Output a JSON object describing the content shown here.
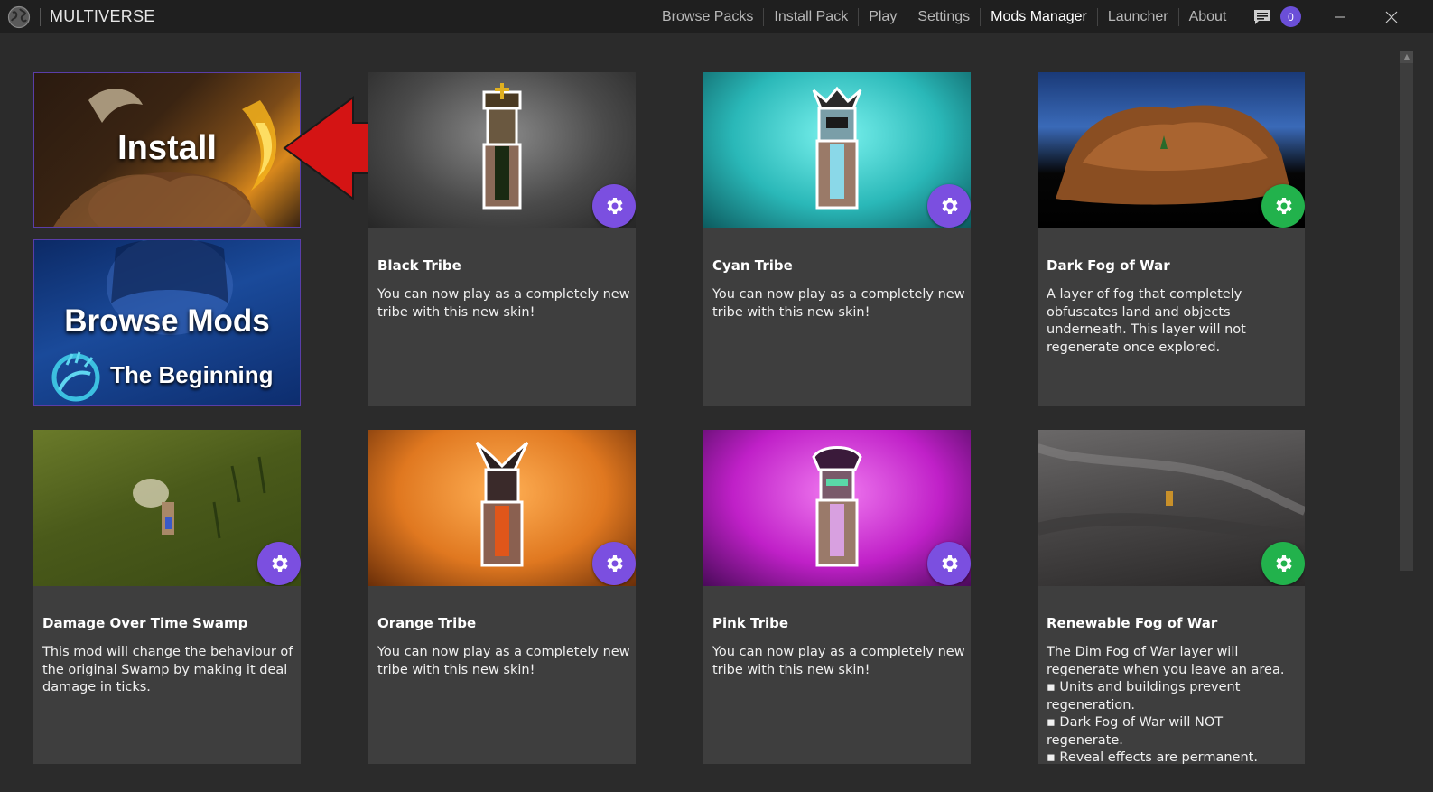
{
  "app": {
    "title": "MULTIVERSE"
  },
  "nav": {
    "items": [
      {
        "label": "Browse Packs"
      },
      {
        "label": "Install Pack"
      },
      {
        "label": "Play"
      },
      {
        "label": "Settings"
      },
      {
        "label": "Mods Manager"
      },
      {
        "label": "Launcher"
      },
      {
        "label": "About"
      }
    ],
    "active": "Mods Manager",
    "notification_count": "0"
  },
  "tiles": {
    "install_label": "Install",
    "browse_label": "Browse Mods",
    "browse_sublabel": "The Beginning"
  },
  "cards": [
    {
      "title": "Black Tribe",
      "description": "You can now play as a completely new tribe with this new skin!",
      "gear_color": "#7b4fe0"
    },
    {
      "title": "Cyan Tribe",
      "description": "You can now play as a completely new tribe with this new skin!",
      "gear_color": "#7b4fe0"
    },
    {
      "title": "Dark Fog of War",
      "description": "A layer of fog that completely obfuscates land and objects underneath. This layer will not regenerate once explored.",
      "gear_color": "#22b24c"
    },
    {
      "title": "Damage Over Time Swamp",
      "description": "This mod will change the behaviour of the original Swamp by making it deal damage in ticks.",
      "gear_color": "#7b4fe0"
    },
    {
      "title": "Orange Tribe",
      "description": "You can now play as a completely new tribe with this new skin!",
      "gear_color": "#7b4fe0"
    },
    {
      "title": "Pink Tribe",
      "description": "You can now play as a completely new tribe with this new skin!",
      "gear_color": "#7b4fe0"
    },
    {
      "title": "Renewable Fog of War",
      "description": "The Dim Fog of War layer will regenerate when you leave an area.\n▪ Units and buildings prevent regeneration.\n▪ Dark Fog of War will NOT regenerate.\n▪ Reveal effects are permanent.",
      "gear_color": "#22b24c"
    }
  ],
  "colors": {
    "accent_purple": "#7b4fe0",
    "accent_green": "#22b24c",
    "arrow_red": "#d41414"
  }
}
